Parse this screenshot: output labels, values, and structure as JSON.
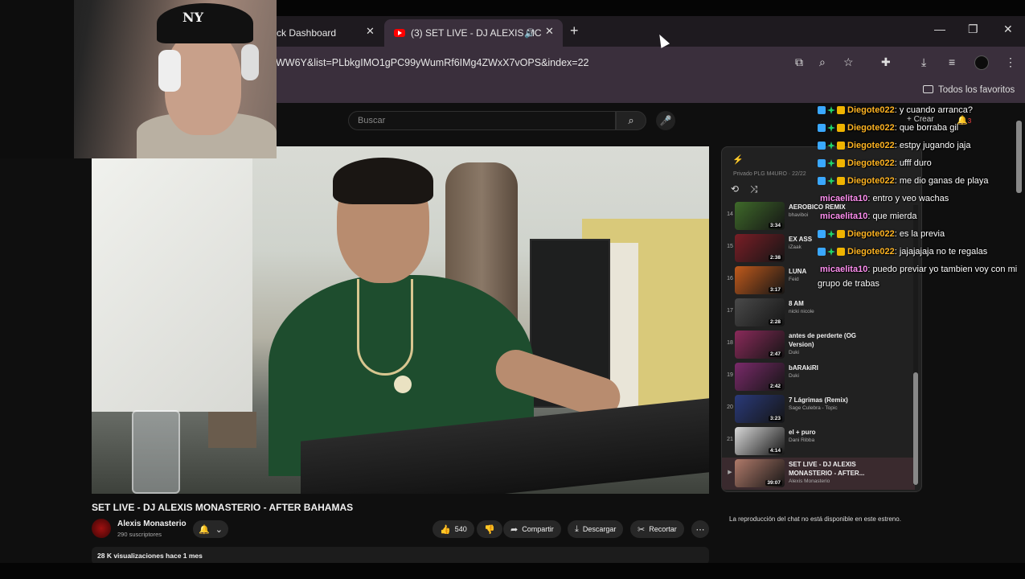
{
  "browser": {
    "tabs": [
      {
        "title": "ck Dashboard",
        "active": false
      },
      {
        "title": "(3) SET LIVE - DJ ALEXIS MC",
        "active": true
      }
    ],
    "url": "WW6Y&list=PLbkgIMO1gPC99yWumRf6IMg4ZWxX7vOPS&index=22",
    "bookmarks_label": "Todos los favoritos"
  },
  "youtube": {
    "search_placeholder": "Buscar",
    "create_label": "Crear",
    "notif_count": "3"
  },
  "video": {
    "title": "SET LIVE - DJ ALEXIS MONASTERIO - AFTER BAHAMAS",
    "channel": "Alexis Monasterio",
    "subscribers": "290 suscriptores",
    "likes": "540",
    "share_label": "Compartir",
    "download_label": "Descargar",
    "clip_label": "Recortar",
    "views_line": "28 K visualizaciones  hace 1 mes"
  },
  "playlist": {
    "subtitle": "Privado PLG  M4URO  ·  22/22",
    "items": [
      {
        "num": "14",
        "title": "AEROBICO REMIX",
        "channel": "bhaviboi",
        "duration": "3:34",
        "color": "#3f6a2a"
      },
      {
        "num": "15",
        "title": "EX ASS",
        "channel": "iZaak",
        "duration": "2:38",
        "color": "#7a1e26"
      },
      {
        "num": "16",
        "title": "LUNA",
        "channel": "Feid",
        "duration": "3:17",
        "color": "#c05a1c"
      },
      {
        "num": "17",
        "title": "8 AM",
        "channel": "nicki nicole",
        "duration": "2:28",
        "color": "#4a4a4a"
      },
      {
        "num": "18",
        "title": "antes de perderte (OG Version)",
        "channel": "Duki",
        "duration": "2:47",
        "color": "#8a2a5a"
      },
      {
        "num": "19",
        "title": "bARAkiRI",
        "channel": "Duki",
        "duration": "2:42",
        "color": "#7a2a6a"
      },
      {
        "num": "20",
        "title": "7 Lágrimas (Remix)",
        "channel": "Sage Culebra - Topic",
        "duration": "3:23",
        "color": "#2a3a7a"
      },
      {
        "num": "21",
        "title": "el + puro",
        "channel": "Dani Ribba",
        "duration": "4:14",
        "color": "#d8d8d8"
      },
      {
        "num": "▶",
        "title": "SET LIVE - DJ ALEXIS MONASTERIO - AFTER...",
        "channel": "Alexis Monasterio",
        "duration": "39:07",
        "color": "#b07a6a"
      }
    ],
    "chat_unavailable": "La reproducción del chat no está disponible en este estreno."
  },
  "chat": [
    {
      "user": "Diegote022",
      "text": ": y cuando arranca?",
      "badges": true
    },
    {
      "user": "Diegote022",
      "text": ": que borraba gil",
      "badges": true
    },
    {
      "user": "Diegote022",
      "text": ": estpy jugando jaja",
      "badges": true
    },
    {
      "user": "Diegote022",
      "text": ": ufff duro",
      "badges": true
    },
    {
      "user": "Diegote022",
      "text": ": me dio ganas de playa",
      "badges": true
    },
    {
      "user": "micaelita10",
      "text": ": entro y veo wachas",
      "badges": false
    },
    {
      "user": "micaelita10",
      "text": ": que mierda",
      "badges": false
    },
    {
      "user": "Diegote022",
      "text": ": es la previa",
      "badges": true
    },
    {
      "user": "Diegote022",
      "text": ": jajajajaja no te regalas",
      "badges": true
    },
    {
      "user": "micaelita10",
      "text": ": puedo previar yo tambien voy con mi grupo de trabas",
      "badges": false
    }
  ]
}
